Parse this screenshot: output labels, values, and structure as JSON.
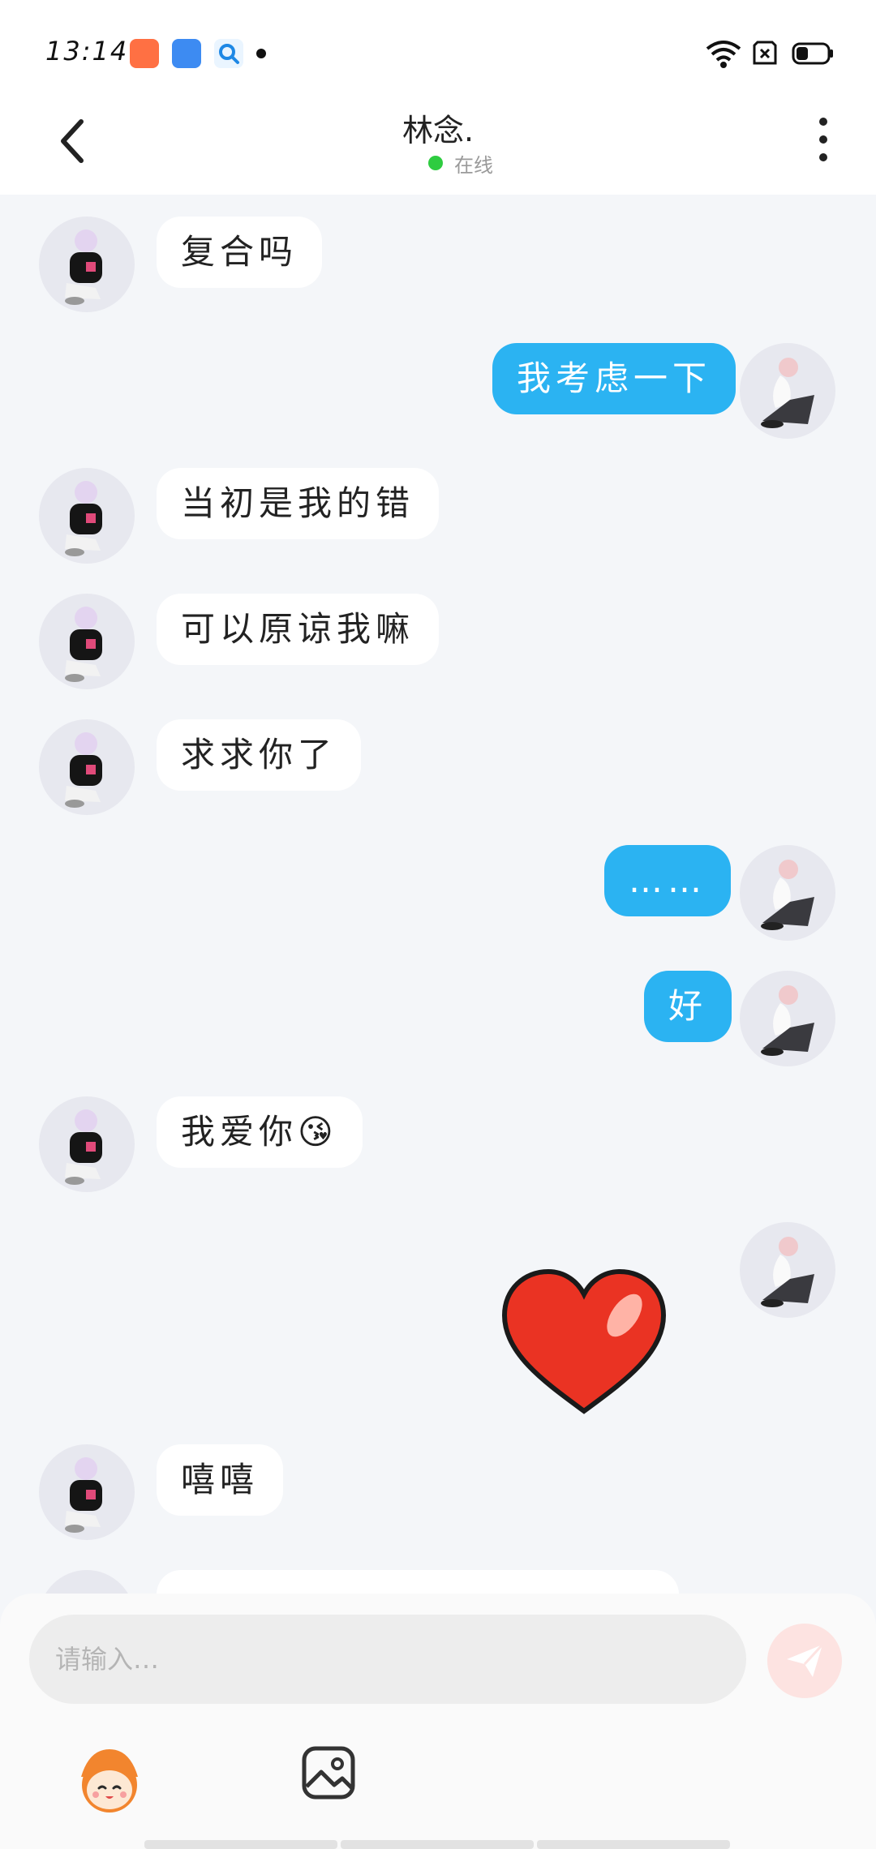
{
  "status_bar": {
    "time": "13:14",
    "apps": [
      "gallery-app-icon",
      "browser-app-icon",
      "search-app-icon"
    ],
    "indicators": [
      "wifi-icon",
      "sim-icon",
      "battery-icon"
    ]
  },
  "header": {
    "title": "林念.",
    "status": "在线",
    "status_color": "#2ecc40"
  },
  "messages": [
    {
      "side": "in",
      "text": "复合吗"
    },
    {
      "side": "out",
      "text": "我考虑一下"
    },
    {
      "side": "in",
      "text": "当初是我的错"
    },
    {
      "side": "in",
      "text": "可以原谅我嘛"
    },
    {
      "side": "in",
      "text": "求求你了"
    },
    {
      "side": "out",
      "text": "……"
    },
    {
      "side": "out",
      "text": "好"
    },
    {
      "side": "in",
      "text": "我爱你😘"
    },
    {
      "side": "out",
      "sticker": "heart-sticker"
    },
    {
      "side": "in",
      "text": "嘻嘻"
    }
  ],
  "input": {
    "placeholder": "请输入…"
  },
  "colors": {
    "out_bubble": "#2bb3f2",
    "in_bubble": "#ffffff",
    "background": "#f4f6f9"
  }
}
